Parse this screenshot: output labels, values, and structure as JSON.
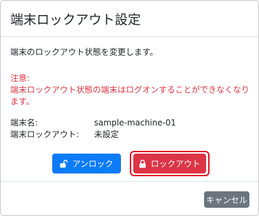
{
  "dialog": {
    "title": "端末ロックアウト設定",
    "description": "端末のロックアウト状態を変更します。",
    "warning_title": "注意:",
    "warning_text": "端末ロックアウト状態の端末はログオンすることができなくなります。",
    "machine_label": "端末名:",
    "machine_value": "sample-machine-01",
    "lockout_label": "端末ロックアウト:",
    "lockout_value": "未設定"
  },
  "buttons": {
    "unlock_label": "アンロック",
    "lock_label": "ロックアウト",
    "cancel_label": "キャンセル"
  },
  "colors": {
    "primary": "#0d7bf7",
    "danger": "#dc3545",
    "secondary": "#6c757d",
    "focus_ring": "#e0101f"
  },
  "icons": {
    "unlock": "unlock-icon",
    "lock": "lock-icon"
  }
}
